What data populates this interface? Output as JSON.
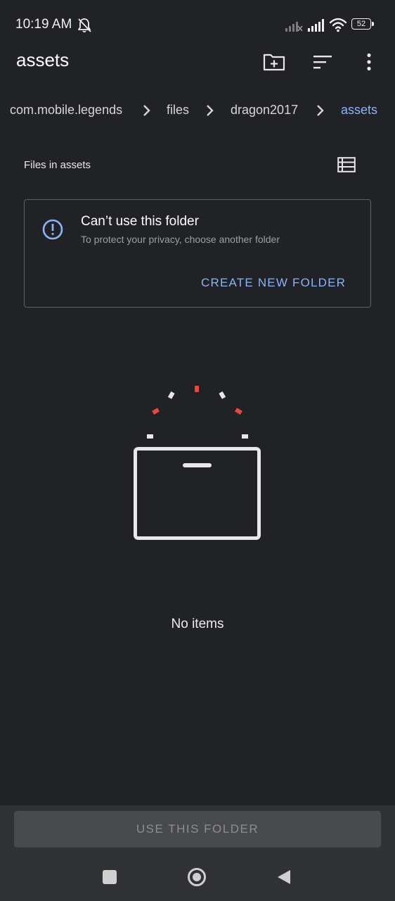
{
  "status_bar": {
    "time": "10:19 AM",
    "battery_level": "52",
    "icons": [
      "mute-bell-icon",
      "signal-no-sim-icon",
      "signal-icon",
      "wifi-icon",
      "battery-icon"
    ]
  },
  "app_bar": {
    "title": "assets",
    "actions": [
      "new-folder-icon",
      "sort-icon",
      "more-vert-icon"
    ]
  },
  "breadcrumb": {
    "items": [
      "com.mobile.legends",
      "files",
      "dragon2017",
      "assets"
    ]
  },
  "file_list": {
    "header": "Files in assets",
    "view_toggle_icon": "list-view-icon"
  },
  "warning_card": {
    "title": "Can’t use this folder",
    "subtitle": "To protect your privacy, choose another folder",
    "action": "CREATE NEW FOLDER",
    "icon": "info-icon"
  },
  "empty_state": {
    "text": "No items",
    "illustration": "empty-box-icon"
  },
  "bottom": {
    "use_button": "USE THIS FOLDER"
  },
  "nav_bar": {
    "icons": [
      "recents-icon",
      "home-icon",
      "back-icon"
    ]
  },
  "colors": {
    "background": "#212226",
    "accent": "#8ab4f8",
    "bottom_panel": "#313236",
    "illustration_red": "#e8473d"
  }
}
